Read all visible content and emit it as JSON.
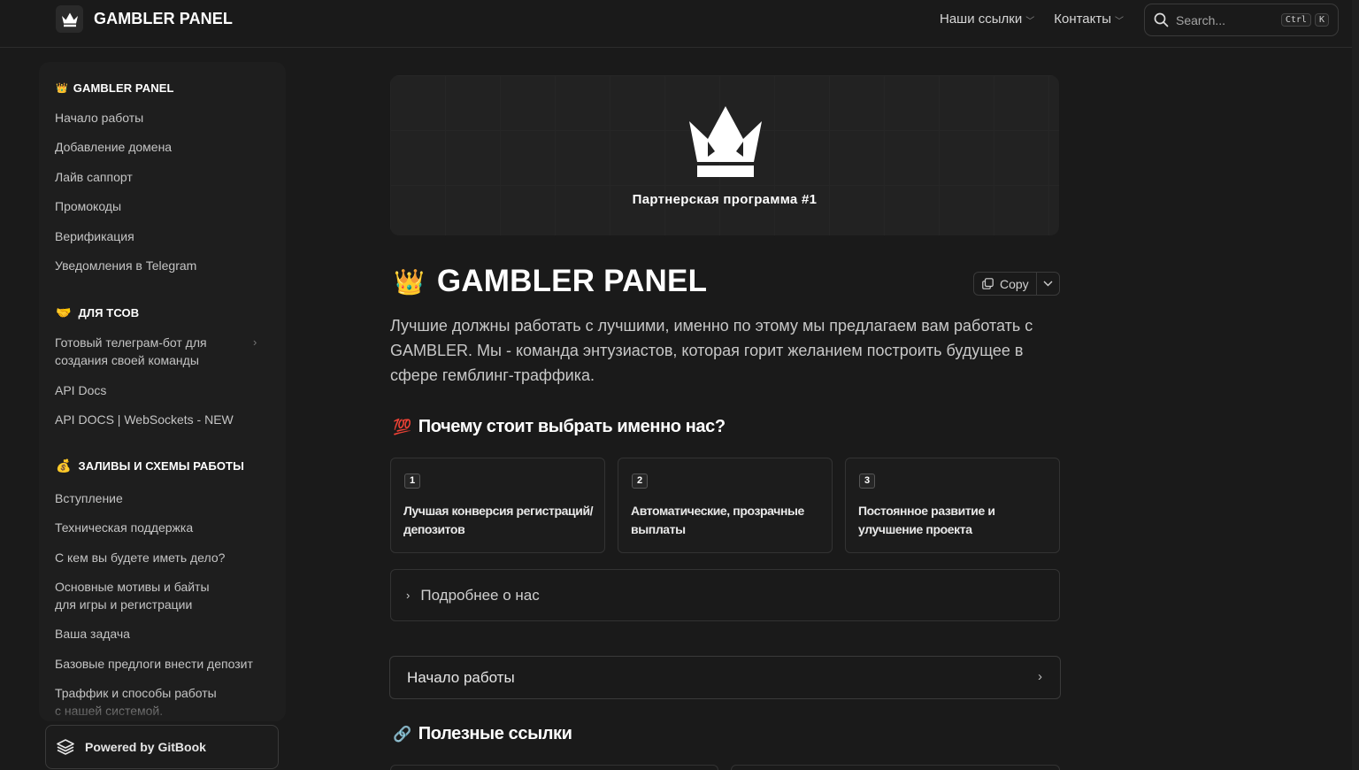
{
  "header": {
    "brand_title": "GAMBLER PANEL",
    "nav": [
      {
        "label": "Наши ссылки"
      },
      {
        "label": "Контакты"
      }
    ],
    "search": {
      "placeholder": "Search...",
      "shortcut": [
        "Ctrl",
        "K"
      ]
    }
  },
  "sidebar": {
    "sections": [
      {
        "title": "GAMBLER PANEL",
        "emoji": "👑",
        "items": [
          "Начало работы",
          "Добавление домена",
          "Лайв саппорт",
          "Промокоды",
          "Верификация",
          "Уведомления в Telegram"
        ]
      },
      {
        "title": "ДЛЯ ТСОВ",
        "emoji": "🤝",
        "items": [
          "Готовый телеграм-бот для создания своей команды",
          "API Docs",
          "API DOCS | WebSockets - NEW"
        ]
      },
      {
        "title": "ЗАЛИВЫ И СХЕМЫ РАБОТЫ",
        "emoji": "💰",
        "items": [
          "Вступление",
          "Техническая поддержка",
          "С кем вы будете иметь дело?",
          "Основные мотивы и байты для игры и регистрации",
          "Ваша задача",
          "Базовые предлоги внести депозит",
          "Траффик и способы работы с нашей системой."
        ]
      }
    ],
    "powered_by": "Powered by GitBook"
  },
  "main": {
    "hero_caption": "Партнерская программа #1",
    "title_emoji": "👑",
    "title": "GAMBLER PANEL",
    "copy_label": "Copy",
    "lead": "Лучшие должны работать с лучшими, именно по этому мы предлагаем вам работать с GAMBLER. Мы - команда энтузиастов, которая горит желанием построить будущее в сфере гемблинг-траффика.",
    "why_heading": {
      "emoji": "💯",
      "text": "Почему стоит выбрать именно нас?"
    },
    "cards": [
      {
        "num": "1",
        "text": "Лучшая конверсия регистраций/депозитов"
      },
      {
        "num": "2",
        "text": "Автоматические, прозрачные выплаты"
      },
      {
        "num": "3",
        "text": "Постоянное развитие и улучшение проекта"
      }
    ],
    "details_label": "Подробнее о нас",
    "next_label": "Начало работы",
    "links_heading": {
      "emoji": "🔗",
      "text": "Полезные ссылки"
    }
  },
  "colors": {
    "background": "#1a1a1a",
    "sidebar": "#1e1e1e",
    "text": "#d9d9d9",
    "heading": "#ffffff"
  }
}
